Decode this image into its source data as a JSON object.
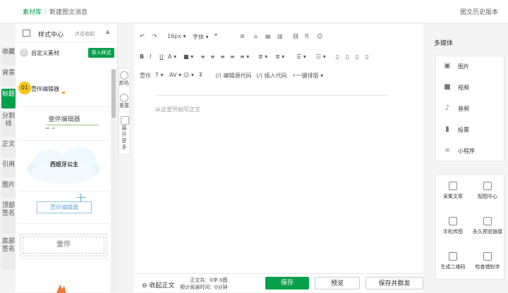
{
  "header": {
    "breadcrumb_root": "素材库",
    "breadcrumb_sep": "/",
    "breadcrumb_current": "新建图文消息",
    "history": "图文历史版本"
  },
  "vtabs": [
    "收藏",
    "背景",
    "标题",
    "分割线",
    "正文",
    "引用",
    "图片",
    "顶部签名",
    "底部签名"
  ],
  "left_panel": {
    "title": "样式中心",
    "collapse": "点击收起",
    "arrow": "▲",
    "custom": "自定义素材",
    "custom_icon": "?",
    "import": "导入样式"
  },
  "templates": {
    "t1_num": "01",
    "t1_text": "壹伴编辑器",
    "t2_text": "壹伴编辑器",
    "t3_text": "西班牙公主",
    "t4_text": "壹伴编辑器",
    "t5_text": "壹伴"
  },
  "tools": {
    "color": "颜色",
    "reset": "重置",
    "more": "展开更多"
  },
  "toolbar1": [
    "↶",
    "↷",
    "16px ▾",
    "字体 ▾",
    "❞",
    "⊘",
    "⌂",
    "▤",
    "▥",
    "⛓",
    "⎘",
    "☺"
  ],
  "toolbar2": [
    "B",
    "I",
    "U",
    "A ▾",
    "■ ▾",
    "≡",
    "≡",
    "≡",
    "≡",
    "≡ ▾",
    "≣ ▾",
    "≣ ▾",
    "☰ ▾",
    "☷ ▾",
    "▯",
    "▯",
    "▯",
    "▯"
  ],
  "toolbar3": {
    "yiban": "壹伴",
    "t1": "T ▾",
    "t2": "AV ▾",
    "emoji": "☺ ▾",
    "strike": "T̶",
    "source": "⟨/⟩ 编辑源代码",
    "insert": "⟨/⟩ 插入代码",
    "format": "⚡一键排版 ▾"
  },
  "editor": {
    "placeholder": "从这里开始写正文"
  },
  "footer": {
    "collapse": "收起正文",
    "body_label": "正文共：",
    "chars": "0字",
    "images": "0图",
    "read_label": "预计阅读时间：",
    "read_time": "0分钟",
    "save": "保存",
    "preview": "预览",
    "send": "保存并群发"
  },
  "right_panel": {
    "title": "多媒体",
    "media": [
      {
        "icon": "▣",
        "label": "图片"
      },
      {
        "icon": "■",
        "label": "视频"
      },
      {
        "icon": "♪",
        "label": "音频"
      },
      {
        "icon": "▮",
        "label": "投票"
      },
      {
        "icon": "∞",
        "label": "小程序"
      }
    ],
    "tools": [
      "采集文章",
      "配图中心",
      "手机传图",
      "永久预览链接",
      "生成二维码",
      "检查错别字"
    ]
  }
}
